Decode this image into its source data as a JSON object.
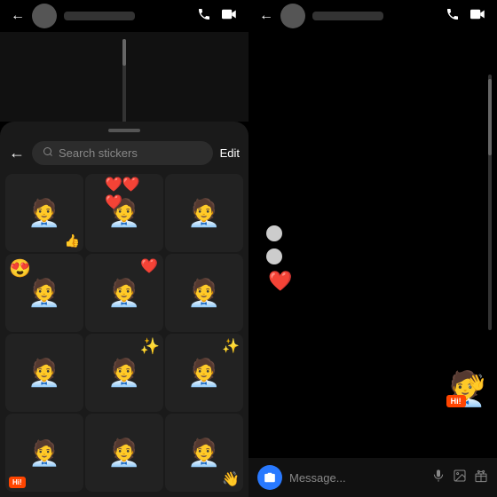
{
  "left": {
    "statusBar": {
      "backLabel": "←",
      "phoneIcon": "📞",
      "videoIcon": "⬜"
    },
    "tray": {
      "searchPlaceholder": "Search stickers",
      "editLabel": "Edit"
    },
    "stickers": [
      {
        "id": 1,
        "emoji": "🧑‍💼",
        "overlay": "👍",
        "type": "thumbsup"
      },
      {
        "id": 2,
        "emoji": "🧑‍💼",
        "overlay": "❤️❤️❤️",
        "type": "hearts"
      },
      {
        "id": 3,
        "emoji": "🧑‍💼",
        "overlay": "",
        "type": "plain"
      },
      {
        "id": 4,
        "emoji": "🧑‍💼",
        "overlay": "😍",
        "type": "heart-eyes"
      },
      {
        "id": 5,
        "emoji": "🧑‍💼",
        "overlay": "❤️",
        "type": "single-heart"
      },
      {
        "id": 6,
        "emoji": "🧑‍💼",
        "overlay": "",
        "type": "plain"
      },
      {
        "id": 7,
        "emoji": "🧑‍💼",
        "overlay": "",
        "type": "plain"
      },
      {
        "id": 8,
        "emoji": "🧑‍💼",
        "overlay": "✨",
        "type": "sparkle"
      },
      {
        "id": 9,
        "emoji": "🧑‍💼",
        "overlay": "✨",
        "type": "sparkle2"
      },
      {
        "id": 10,
        "emoji": "🧑‍💼",
        "overlay": "Hi!",
        "type": "hi",
        "hiBadge": true
      },
      {
        "id": 11,
        "emoji": "🧑‍💼",
        "overlay": "",
        "type": "plain"
      },
      {
        "id": 12,
        "emoji": "🧑‍💼",
        "overlay": "👋",
        "type": "wave"
      }
    ]
  },
  "right": {
    "statusBar": {
      "backLabel": "←",
      "phoneIcon": "📞",
      "videoIcon": "⬜"
    },
    "floatingHeart": "❤️",
    "messageBar": {
      "placeholder": "Message...",
      "cameraIcon": "📷",
      "micIcon": "🎤",
      "imgIcon": "🖼",
      "giftIcon": "🎁"
    }
  }
}
